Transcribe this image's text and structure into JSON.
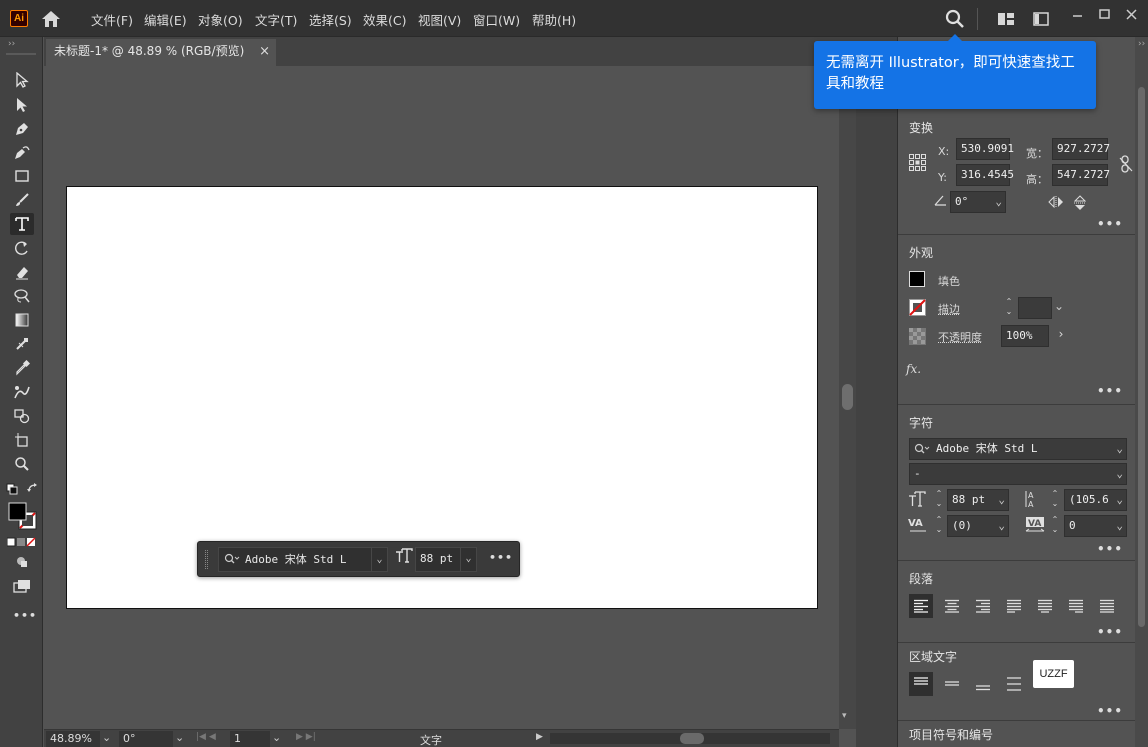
{
  "app": {
    "logo": "Ai"
  },
  "menu": [
    {
      "label": "文件(F)"
    },
    {
      "label": "编辑(E)"
    },
    {
      "label": "对象(O)"
    },
    {
      "label": "文字(T)"
    },
    {
      "label": "选择(S)"
    },
    {
      "label": "效果(C)"
    },
    {
      "label": "视图(V)"
    },
    {
      "label": "窗口(W)"
    },
    {
      "label": "帮助(H)"
    }
  ],
  "document": {
    "tab_title": "未标题-1* @ 48.89 % (RGB/预览)",
    "close_glyph": "×"
  },
  "tooltip": {
    "text": "无需离开 Illustrator，即可快速查找工具和教程"
  },
  "status": {
    "zoom": "48.89%",
    "rotation": "0°",
    "artboard": "1",
    "tool": "文字"
  },
  "float_toolbar": {
    "font": "Adobe 宋体 Std L",
    "size": "88 pt",
    "more": "•••"
  },
  "panel": {
    "transform": {
      "title": "变换",
      "x_label": "X:",
      "x": "530.9091",
      "y_label": "Y:",
      "y": "316.4545",
      "w_label": "宽：",
      "w": "927.2727",
      "h_label": "高：",
      "h": "547.2727",
      "angle": "0°"
    },
    "appearance": {
      "title": "外观",
      "fill": "填色",
      "stroke": "描边",
      "opacity_label": "不透明度",
      "opacity": "100%",
      "fx": "fx."
    },
    "character": {
      "title": "字符",
      "font": "Adobe 宋体 Std L",
      "style": "-",
      "size": "88 pt",
      "leading": "(105.6",
      "kerning": "(0)",
      "tracking": "0"
    },
    "paragraph": {
      "title": "段落"
    },
    "area_type": {
      "title": "区域文字"
    },
    "bullets": {
      "title": "项目符号和编号"
    }
  },
  "watermark": "UZZF",
  "more_glyph": "•••",
  "colors": {
    "accent": "#1473e6",
    "panel_bg": "#535353",
    "menubar_bg": "#323232",
    "toolbar_bg": "#424242"
  }
}
